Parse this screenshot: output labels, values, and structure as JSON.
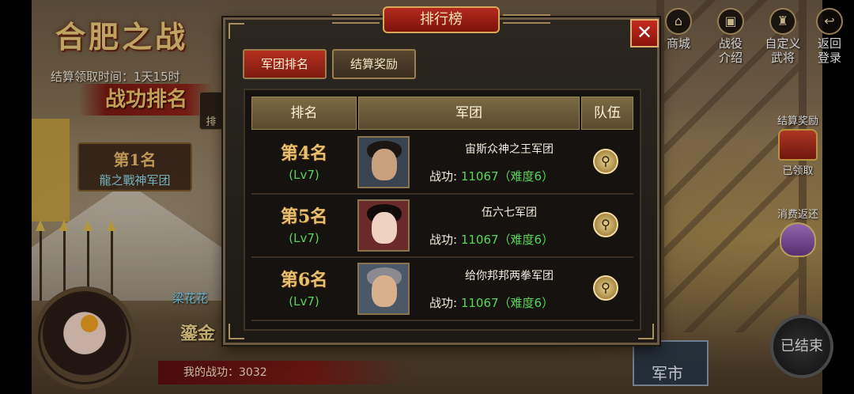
{
  "hud": {
    "battle_title": "合肥之战",
    "settle_time": "结算领取时间：1天15时",
    "merit_rank_title": "战功排名",
    "side_tab": "排",
    "first_place": {
      "rank": "第1名",
      "legion": "龍之戰神军团"
    },
    "player_name": "梁花花",
    "gold_tag": "鎏金",
    "my_merit": "我的战功：3032"
  },
  "top_icons": [
    {
      "icon": "shop-icon",
      "label": "商城"
    },
    {
      "icon": "campaign-icon",
      "label": "战役介绍"
    },
    {
      "icon": "general-icon",
      "label": "自定义武将"
    },
    {
      "icon": "return-icon",
      "label": "返回登录"
    }
  ],
  "side_rewards": {
    "settle_reward": {
      "label": "结算奖励",
      "status": "已领取"
    },
    "consume_refund": {
      "label": "消费返还"
    }
  },
  "ended_button": "已结束",
  "market_button": "军市",
  "modal": {
    "title": "排行榜",
    "close": "✕",
    "tabs": [
      {
        "label": "军团排名",
        "active": true
      },
      {
        "label": "结算奖励",
        "active": false
      }
    ],
    "columns": [
      "排名",
      "军团",
      "队伍"
    ],
    "rows": [
      {
        "rank": "第4名",
        "level": "(Lv7)",
        "legion": "宙斯众神之王军团",
        "merit_label": "战功:",
        "merit_value": "11067（难度6）",
        "portrait": "bearded-warrior"
      },
      {
        "rank": "第5名",
        "level": "(Lv7)",
        "legion": "伍六七军团",
        "merit_label": "战功:",
        "merit_value": "11067（难度6）",
        "portrait": "female-warrior"
      },
      {
        "rank": "第6名",
        "level": "(Lv7)",
        "legion": "给你邦邦两拳军团",
        "merit_label": "战功:",
        "merit_value": "11067（难度6）",
        "portrait": "helmeted-warrior"
      }
    ]
  },
  "colors": {
    "accent_red": "#b5301f",
    "gold": "#e8c070",
    "green_text": "#58d858",
    "panel_bg": "#151210"
  }
}
